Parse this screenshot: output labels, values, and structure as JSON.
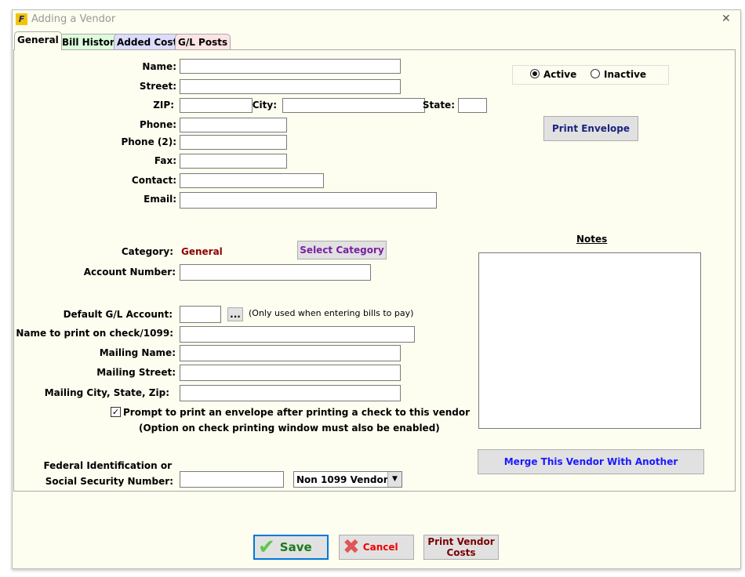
{
  "window": {
    "title": "Adding a Vendor",
    "close": "✕"
  },
  "tabs": [
    {
      "label": "General",
      "color": "#fdfdf0"
    },
    {
      "label": "Bill History",
      "color": "#dcfcdc"
    },
    {
      "label": "Added Costs",
      "color": "#dcdcfc"
    },
    {
      "label": "G/L Posts",
      "color": "#fce4e4"
    }
  ],
  "labels": {
    "name": "Name:",
    "street": "Street:",
    "zip": "ZIP:",
    "city": "City:",
    "state": "State:",
    "phone": "Phone:",
    "phone2": "Phone (2):",
    "fax": "Fax:",
    "contact": "Contact:",
    "email": "Email:",
    "category": "Category:",
    "account": "Account Number:",
    "gl": "Default G/L Account:",
    "gl_note": "(Only used when entering bills to pay)",
    "check_name": "Name to print on check/1099:",
    "mail_name": "Mailing Name:",
    "mail_street": "Mailing Street:",
    "mail_city": "Mailing City, State, Zip:",
    "fed1": "Federal Identification or",
    "fed2": "Social Security Number:",
    "notes": "Notes"
  },
  "category_value": "General",
  "status": {
    "active": "Active",
    "inactive": "Inactive",
    "selected": "Active"
  },
  "buttons": {
    "print_envelope": "Print Envelope",
    "select_category": "Select Category",
    "ellipsis": "...",
    "merge": "Merge This Vendor With Another",
    "save": "Save",
    "cancel": "Cancel",
    "print_costs1": "Print Vendor",
    "print_costs2": "Costs"
  },
  "prompt": {
    "label": "Prompt to print an envelope after printing a check to this vendor",
    "note": "(Option on check printing window must also be enabled)",
    "checked": true
  },
  "vendor_type": "Non 1099 Vendor"
}
